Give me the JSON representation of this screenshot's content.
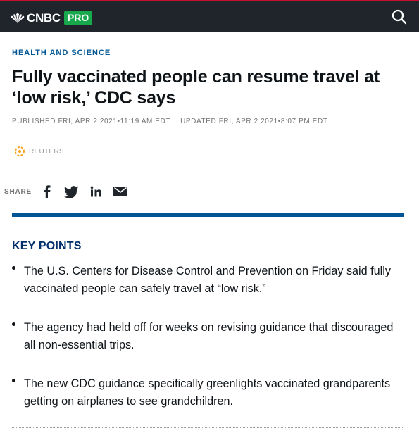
{
  "header": {
    "logo_text": "CNBC",
    "pro_label": "PRO",
    "colors": {
      "bar": "#1f252b",
      "accent": "#c8102e",
      "pro": "#17a94b"
    },
    "search_icon": "search-icon"
  },
  "article": {
    "section": "HEALTH AND SCIENCE",
    "headline": "Fully vaccinated people can resume travel at ‘low risk,’ CDC says",
    "published": "PUBLISHED FRI, APR 2 2021•11:19 AM EDT",
    "updated": "UPDATED FRI, APR 2 2021•8:07 PM EDT",
    "source": "REUTERS"
  },
  "share": {
    "label": "SHARE",
    "icons": [
      "facebook-icon",
      "twitter-icon",
      "linkedin-icon",
      "email-icon"
    ]
  },
  "key_points": {
    "title": "KEY POINTS",
    "items": [
      "The U.S. Centers for Disease Control and Prevention on Friday said fully vaccinated people can safely travel at “low risk.”",
      "The agency had held off for weeks on revising guidance that discouraged all non-essential trips.",
      "The new CDC guidance specifically greenlights vaccinated grandparents getting on airplanes to see grandchildren."
    ]
  }
}
